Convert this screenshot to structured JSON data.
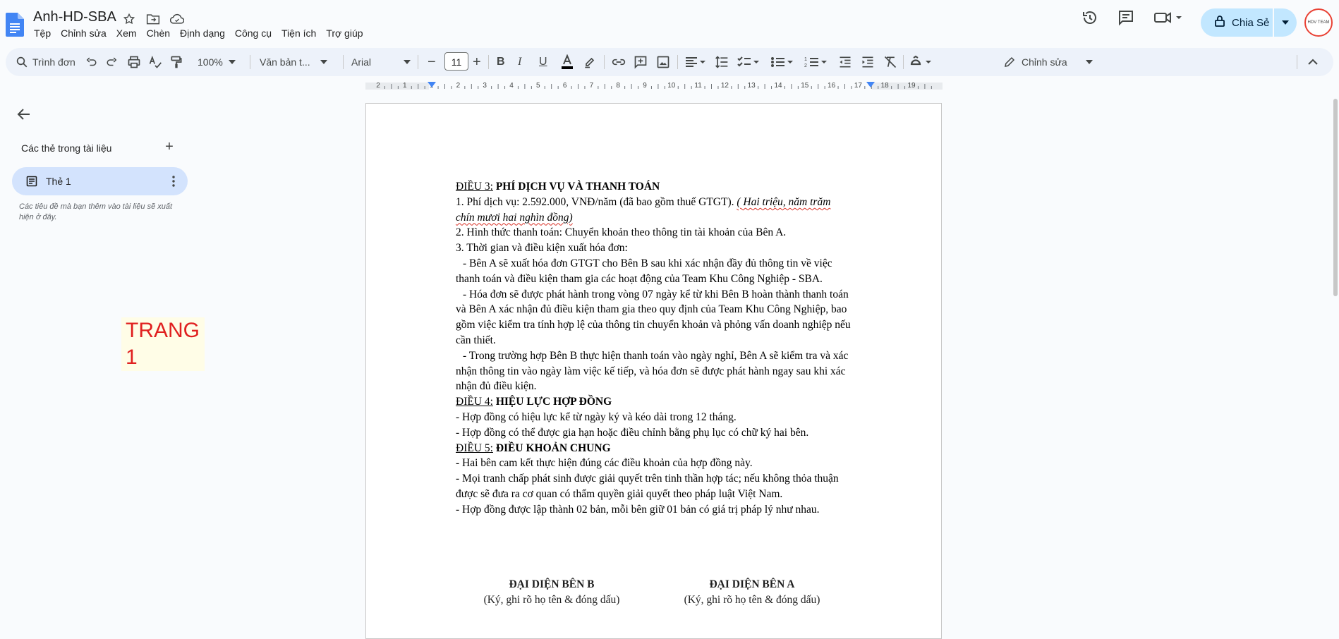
{
  "app": {
    "doc_title": "Anh-HD-SBA",
    "menu": [
      "Tệp",
      "Chỉnh sửa",
      "Xem",
      "Chèn",
      "Định dạng",
      "Công cụ",
      "Tiện ích",
      "Trợ giúp"
    ],
    "share_label": "Chia Sẻ",
    "avatar_text": "HDV TEAM"
  },
  "toolbar": {
    "search_placeholder": "Trình đơn",
    "zoom": "100%",
    "style": "Văn bản t...",
    "font": "Arial",
    "font_size": "11",
    "mode": "Chỉnh sửa"
  },
  "ruler": {
    "labels": [
      "2",
      "1",
      "1",
      "2",
      "3",
      "4",
      "5",
      "6",
      "7",
      "8",
      "9",
      "10",
      "11",
      "12",
      "13",
      "14",
      "15",
      "16",
      "17",
      "18",
      "19"
    ]
  },
  "sidebar": {
    "title": "Các thẻ trong tài liệu",
    "tab_label": "Thẻ 1",
    "note": "Các tiêu đề mà bạn thêm vào tài liệu sẽ xuất hiện ở đây."
  },
  "overlay": {
    "label": "TRANG 1"
  },
  "document": {
    "d3_label": "ĐIỀU 3:",
    "d3_title": "PHÍ DỊCH VỤ VÀ THANH TOÁN",
    "p1_a": "1. Phí dịch vụ: 2.592.000, VNĐ/năm (đã bao gồm thuế GTGT).",
    "p1_b": "( Hai triệu, năm trăm chín mươi hai nghìn đồng)",
    "p2": "2. Hình thức thanh toán: Chuyển khoản theo thông tin tài khoản của Bên A.",
    "p3": "3. Thời gian và điều kiện xuất hóa đơn:",
    "p3a": "- Bên A sẽ xuất hóa đơn GTGT cho Bên B sau khi xác nhận đầy đủ thông tin về việc thanh toán và điều kiện tham gia các hoạt động của Team Khu Công Nghiệp - SBA.",
    "p3b": "- Hóa đơn sẽ được phát hành trong vòng 07 ngày kể từ khi Bên B hoàn thành thanh toán và Bên A xác nhận đủ điều kiện tham gia theo quy định của Team Khu Công Nghiệp, bao gồm việc kiểm tra tính hợp lệ của thông tin chuyển khoản và phỏng vấn doanh nghiệp nếu cần thiết.",
    "p3c": "- Trong trường hợp Bên B thực hiện thanh toán vào ngày nghỉ, Bên A sẽ kiểm tra và xác nhận thông tin vào ngày làm việc kế tiếp, và hóa đơn sẽ được phát hành ngay sau khi xác nhận đủ điều kiện.",
    "d4_label": "ĐIỀU 4:",
    "d4_title": "HIỆU LỰC HỢP ĐỒNG",
    "p4a": "- Hợp đồng có hiệu lực kể từ ngày ký và kéo dài trong 12 tháng.",
    "p4b": "- Hợp đồng có thể được gia hạn hoặc điều chỉnh bằng phụ lục có chữ ký hai bên.",
    "d5_label": "ĐIỀU 5:",
    "d5_title": "ĐIỀU KHOẢN CHUNG",
    "p5a": "- Hai bên cam kết thực hiện đúng các điều khoản của hợp đồng này.",
    "p5b": "- Mọi tranh chấp phát sinh được giải quyết trên tinh thần hợp tác; nếu không thỏa thuận được sẽ đưa ra cơ quan có thẩm quyền giải quyết theo pháp luật Việt Nam.",
    "p5c": "- Hợp đồng được lập thành 02 bản, mỗi bên giữ 01 bản có giá trị pháp lý như nhau.",
    "sig_b_title": "ĐẠI DIỆN BÊN B",
    "sig_b_note": "(Ký, ghi rõ họ tên & đóng dấu)",
    "sig_a_title": "ĐẠI DIỆN BÊN A",
    "sig_a_note": "(Ký, ghi rõ họ tên & đóng dấu)"
  },
  "colors": {
    "accent": "#c2e7ff",
    "tab_active": "#d3e3fd",
    "toolbar_bg": "#edf2fa",
    "overlay_text": "#e02020"
  }
}
